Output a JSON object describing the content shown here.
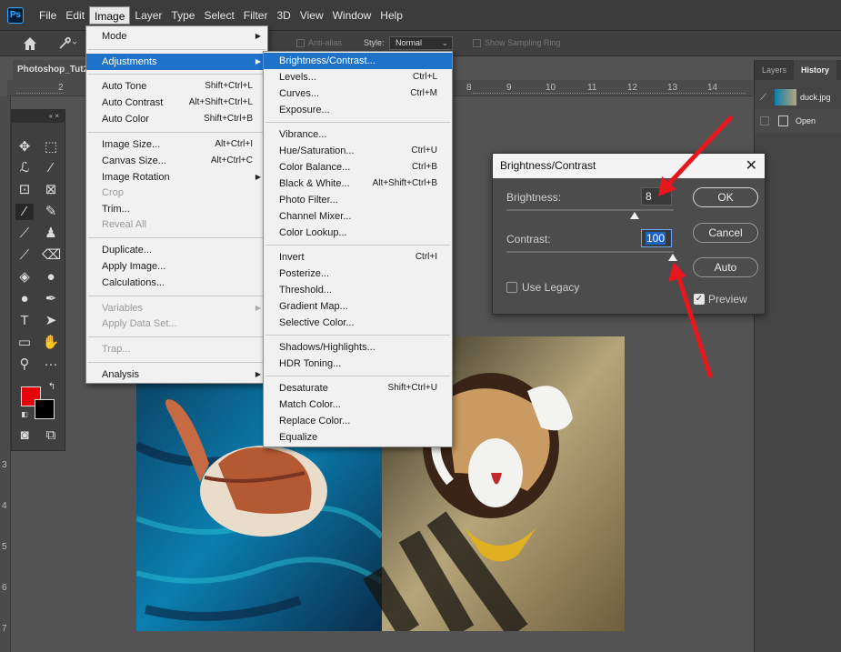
{
  "app": {
    "logo": "Ps"
  },
  "menubar": [
    "File",
    "Edit",
    "Image",
    "Layer",
    "Type",
    "Select",
    "Filter",
    "3D",
    "View",
    "Window",
    "Help"
  ],
  "options": {
    "anti_alias": "Anti-alias",
    "style_label": "Style:",
    "style_value": "Normal",
    "show_sampling": "Show Sampling Ring"
  },
  "document": {
    "tab_title": "Photoshop_Tut2"
  },
  "ruler": {
    "top": [
      "2",
      "8",
      "9",
      "10",
      "11",
      "12",
      "13",
      "14"
    ],
    "left": [
      "3",
      "4",
      "5",
      "6",
      "7"
    ]
  },
  "image_menu": {
    "mode": "Mode",
    "adjustments": "Adjustments",
    "auto_tone": "Auto Tone",
    "auto_tone_sc": "Shift+Ctrl+L",
    "auto_contrast": "Auto Contrast",
    "auto_contrast_sc": "Alt+Shift+Ctrl+L",
    "auto_color": "Auto Color",
    "auto_color_sc": "Shift+Ctrl+B",
    "image_size": "Image Size...",
    "image_size_sc": "Alt+Ctrl+I",
    "canvas_size": "Canvas Size...",
    "canvas_size_sc": "Alt+Ctrl+C",
    "image_rotation": "Image Rotation",
    "crop": "Crop",
    "trim": "Trim...",
    "reveal_all": "Reveal All",
    "duplicate": "Duplicate...",
    "apply_image": "Apply Image...",
    "calculations": "Calculations...",
    "variables": "Variables",
    "apply_data_set": "Apply Data Set...",
    "trap": "Trap...",
    "analysis": "Analysis"
  },
  "adjustments_menu": {
    "brightness_contrast": "Brightness/Contrast...",
    "levels": "Levels...",
    "levels_sc": "Ctrl+L",
    "curves": "Curves...",
    "curves_sc": "Ctrl+M",
    "exposure": "Exposure...",
    "vibrance": "Vibrance...",
    "hue_saturation": "Hue/Saturation...",
    "hue_saturation_sc": "Ctrl+U",
    "color_balance": "Color Balance...",
    "color_balance_sc": "Ctrl+B",
    "black_white": "Black & White...",
    "black_white_sc": "Alt+Shift+Ctrl+B",
    "photo_filter": "Photo Filter...",
    "channel_mixer": "Channel Mixer...",
    "color_lookup": "Color Lookup...",
    "invert": "Invert",
    "invert_sc": "Ctrl+I",
    "posterize": "Posterize...",
    "threshold": "Threshold...",
    "gradient_map": "Gradient Map...",
    "selective_color": "Selective Color...",
    "shadows_highlights": "Shadows/Highlights...",
    "hdr_toning": "HDR Toning...",
    "desaturate": "Desaturate",
    "desaturate_sc": "Shift+Ctrl+U",
    "match_color": "Match Color...",
    "replace_color": "Replace Color...",
    "equalize": "Equalize"
  },
  "dialog": {
    "title": "Brightness/Contrast",
    "brightness_label": "Brightness:",
    "brightness_value": "8",
    "contrast_label": "Contrast:",
    "contrast_value": "100",
    "use_legacy": "Use Legacy",
    "use_legacy_checked": false,
    "preview": "Preview",
    "preview_checked": true,
    "ok": "OK",
    "cancel": "Cancel",
    "auto": "Auto"
  },
  "panels": {
    "tabs": [
      "Layers",
      "History"
    ],
    "history_doc": "duck.jpg",
    "history_open": "Open"
  },
  "colors": {
    "foreground": "#e8000a",
    "background": "#000000",
    "highlight": "#1e72c8",
    "arrow": "#e8171d"
  }
}
